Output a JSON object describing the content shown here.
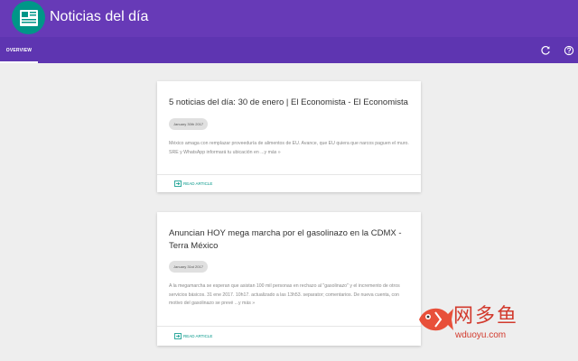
{
  "app": {
    "title": "Noticias del día",
    "logo_icon": "newspaper-icon",
    "brand_color": "#673ab7",
    "tabbar_color": "#5e35b1",
    "logo_color": "#009688"
  },
  "tabs": [
    {
      "label": "OVERVIEW",
      "active": true
    }
  ],
  "toolbar": {
    "refresh_icon": "refresh-icon",
    "help_icon": "help-icon"
  },
  "articles": [
    {
      "title": "5 noticias del día: 30 de enero | El Economista - El Economista",
      "date": "January 30th 2017",
      "summary": "México amaga con remplazar proveeduría de alimentos de EU. Avance, que EU quiera que narcos paguen el muro. SRE y WhatsApp informará tu ubicación en ...y más »",
      "link_label": "READ ARTICLE",
      "link_icon": "open-in-new-icon"
    },
    {
      "title": "Anuncian HOY mega marcha por el gasolinazo en la CDMX - Terra México",
      "date": "January 31st 2017",
      "summary": "A la megamarcha se esperan que asistan 100 mil personas en rechazo al \"gasolinazo\" y el incremento de otros servicios básicos. 31 ene 2017. 10h17. actualizado a las 13h53. separator; comentarios. De nueva cuenta, con motivo del gasolinazo se prevé ...y más »",
      "link_label": "READ ARTICLE",
      "link_icon": "open-in-new-icon"
    }
  ],
  "watermark": {
    "text": "网多鱼",
    "url": "wduoyu.com",
    "color": "#d23a2d"
  }
}
